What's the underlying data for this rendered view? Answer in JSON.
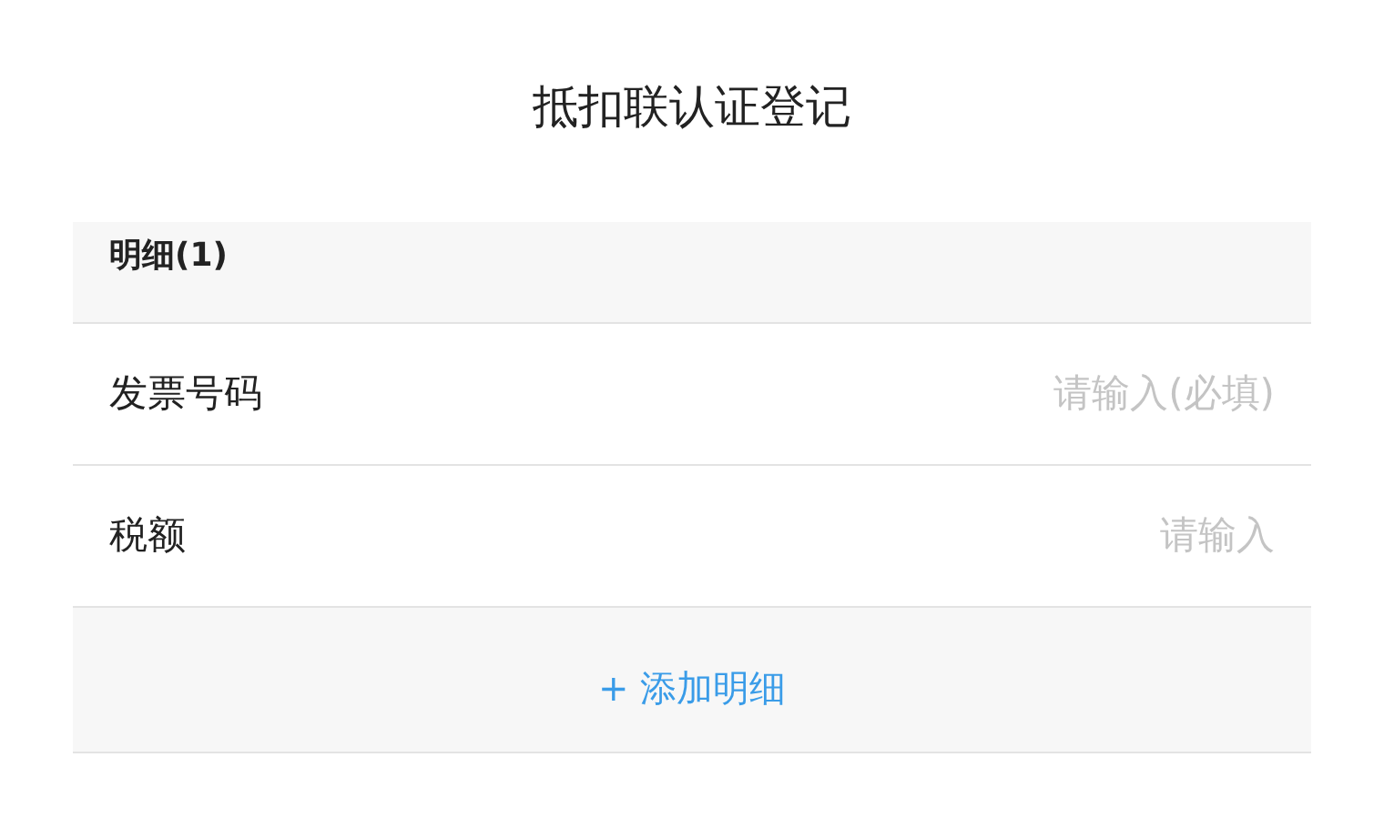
{
  "title": "抵扣联认证登记",
  "section": {
    "title": "明细(1)"
  },
  "fields": [
    {
      "label": "发票号码",
      "placeholder": "请输入(必填)"
    },
    {
      "label": "税额",
      "placeholder": "请输入"
    }
  ],
  "add_button": {
    "label": "+ 添加明细"
  }
}
